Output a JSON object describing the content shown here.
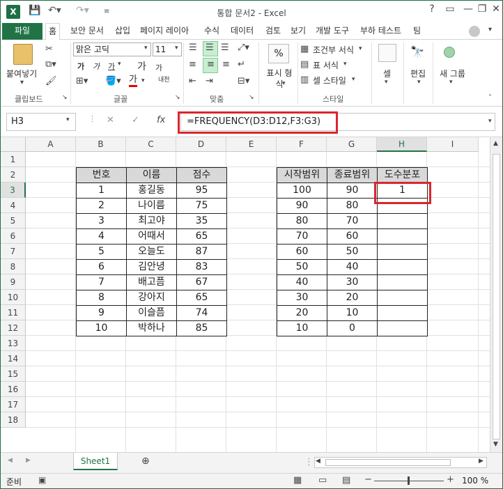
{
  "window": {
    "title": "통합 문서2 - Excel",
    "help": "?",
    "minimize": "—",
    "restore": "❐",
    "close": "✕"
  },
  "colors": {
    "excel_green": "#217346",
    "highlight_red": "#d9262e"
  },
  "ribbon": {
    "tabs": [
      "파일",
      "홈",
      "보안 문서",
      "삽입",
      "페이지 레이아",
      "수식",
      "데이터",
      "검토",
      "보기",
      "개발 도구",
      "부하 테스트",
      "팀"
    ],
    "active_tab": "홈",
    "clipboard": {
      "paste_label": "붙여넣기",
      "group_label": "클립보드"
    },
    "font": {
      "font_name": "맑은 고딕",
      "font_size": "11",
      "bold": "가",
      "italic": "가",
      "underline": "가",
      "grow": "가",
      "shrink": "가",
      "font_color": "가",
      "phonetic": "내천",
      "group_label": "글꼴"
    },
    "alignment": {
      "group_label": "맞춤"
    },
    "number": {
      "format_label": "표시 형식",
      "percent": "%",
      "group_label": ""
    },
    "styles": {
      "conditional": "조건부 서식",
      "table": "표 서식",
      "cell_style": "셀 스타일",
      "group_label": "스타일"
    },
    "cells": {
      "label": "셀"
    },
    "editing": {
      "label": "편집"
    },
    "new_group": {
      "label": "새 그룹"
    }
  },
  "formula_bar": {
    "name_box": "H3",
    "formula": "=FREQUENCY(D3:D12,F3:G3)",
    "fx": "fx"
  },
  "sheet": {
    "columns": [
      "A",
      "B",
      "C",
      "D",
      "E",
      "F",
      "G",
      "H",
      "I"
    ],
    "selected_column": "H",
    "rows": [
      "1",
      "2",
      "3",
      "4",
      "5",
      "6",
      "7",
      "8",
      "9",
      "10",
      "11",
      "12",
      "13",
      "14",
      "15",
      "16",
      "17",
      "18"
    ],
    "selected_row": "3",
    "table1": {
      "headers": [
        "번호",
        "이름",
        "점수"
      ],
      "rows": [
        [
          "1",
          "홍길동",
          "95"
        ],
        [
          "2",
          "나이름",
          "75"
        ],
        [
          "3",
          "최고야",
          "35"
        ],
        [
          "4",
          "어때서",
          "65"
        ],
        [
          "5",
          "오늘도",
          "87"
        ],
        [
          "6",
          "김안녕",
          "83"
        ],
        [
          "7",
          "배고픔",
          "67"
        ],
        [
          "8",
          "강아지",
          "65"
        ],
        [
          "9",
          "이슬픔",
          "74"
        ],
        [
          "10",
          "박하나",
          "85"
        ]
      ]
    },
    "table2": {
      "headers": [
        "시작범위",
        "종료범위",
        "도수분포"
      ],
      "rows": [
        [
          "100",
          "90",
          "1"
        ],
        [
          "90",
          "80",
          ""
        ],
        [
          "80",
          "70",
          ""
        ],
        [
          "70",
          "60",
          ""
        ],
        [
          "60",
          "50",
          ""
        ],
        [
          "50",
          "40",
          ""
        ],
        [
          "40",
          "30",
          ""
        ],
        [
          "30",
          "20",
          ""
        ],
        [
          "20",
          "10",
          ""
        ],
        [
          "10",
          "0",
          ""
        ]
      ]
    },
    "sheet_tab": "Sheet1"
  },
  "status": {
    "ready": "준비",
    "zoom": "100 %"
  }
}
